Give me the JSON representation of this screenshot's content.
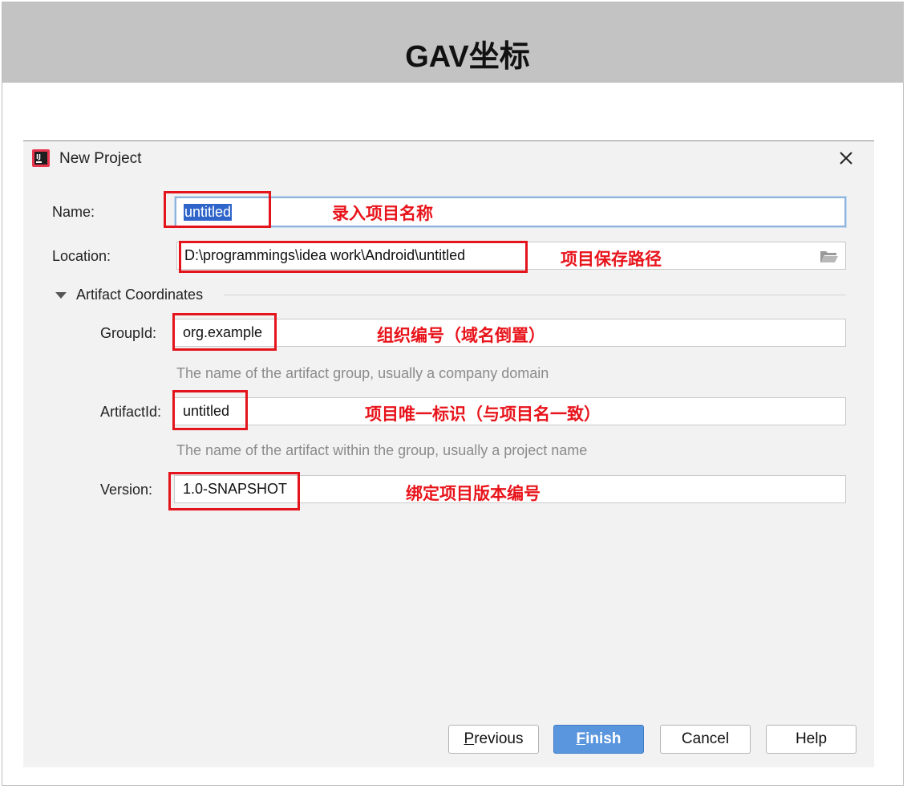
{
  "banner": {
    "title": "GAV坐标"
  },
  "dialog": {
    "title": "New Project"
  },
  "form": {
    "name_label": "Name:",
    "name_value": "untitled",
    "location_label": "Location:",
    "location_value": "D:\\programmings\\idea work\\Android\\untitled",
    "section_label": "Artifact Coordinates",
    "groupid_label": "GroupId:",
    "groupid_value": "org.example",
    "groupid_hint": "The name of the artifact group, usually a company domain",
    "artifactid_label": "ArtifactId:",
    "artifactid_value": "untitled",
    "artifactid_hint": "The name of the artifact within the group, usually a project name",
    "version_label": "Version:",
    "version_value": "1.0-SNAPSHOT"
  },
  "buttons": {
    "previous_mnemonic": "P",
    "previous_rest": "revious",
    "finish_mnemonic": "F",
    "finish_rest": "inish",
    "cancel": "Cancel",
    "help": "Help"
  },
  "annotations": {
    "name": "录入项目名称",
    "location": "项目保存路径",
    "groupid": "组织编号（域名倒置）",
    "artifactid": "项目唯一标识（与项目名一致）",
    "version": "绑定项目版本编号"
  },
  "colors": {
    "banner": "#c3c3c3",
    "dialog_bg": "#f2f2f2",
    "selection": "#2f65ca",
    "primary_button": "#5a96de",
    "annotation_red": "#e3141b"
  },
  "icons": {
    "app": "intellij-idea-icon",
    "close": "close-icon",
    "folder": "folder-open-icon",
    "caret": "caret-down-icon"
  }
}
